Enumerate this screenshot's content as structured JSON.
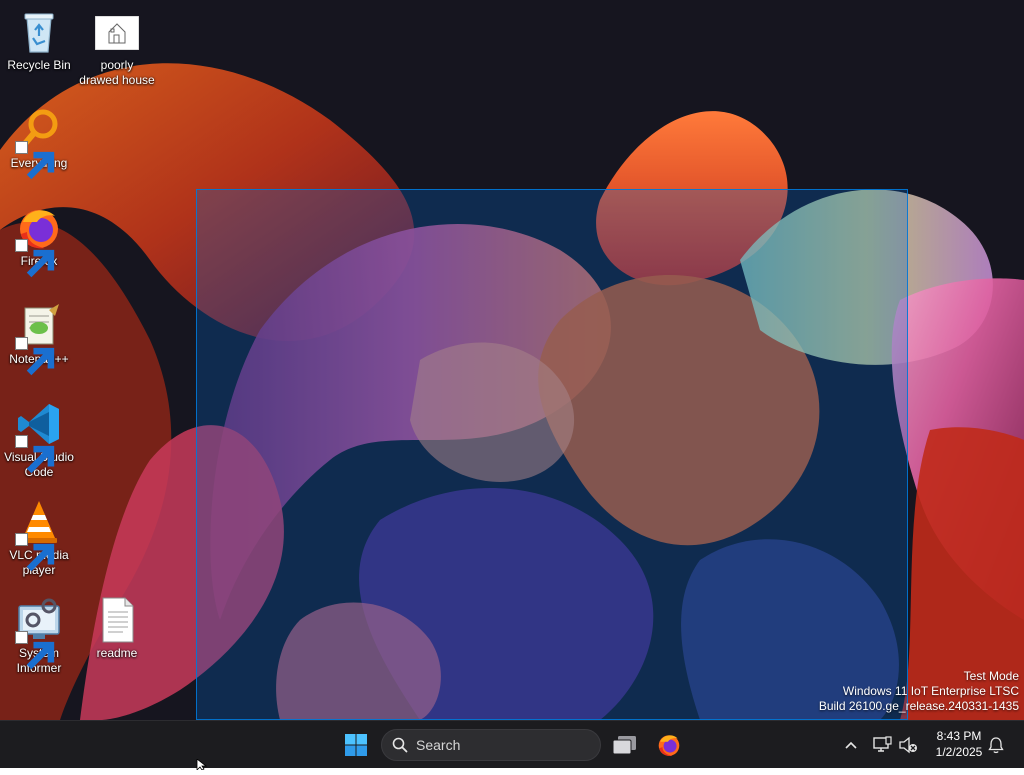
{
  "desktop": {
    "icons": [
      {
        "name": "Recycle Bin",
        "icon": "recycle-bin-icon",
        "shortcut": false
      },
      {
        "name": "poorly\ndrawed house",
        "icon": "image-thumbnail-icon",
        "shortcut": false
      },
      {
        "name": "Everything",
        "icon": "everything-search-icon",
        "shortcut": true
      },
      {
        "name": "Firefox",
        "icon": "firefox-icon",
        "shortcut": true
      },
      {
        "name": "Notepad++",
        "icon": "notepad-plus-plus-icon",
        "shortcut": true
      },
      {
        "name": "Visual Studio\nCode",
        "icon": "vscode-icon",
        "shortcut": true
      },
      {
        "name": "VLC media\nplayer",
        "icon": "vlc-icon",
        "shortcut": true
      },
      {
        "name": "System\nInformer",
        "icon": "system-informer-icon",
        "shortcut": true
      },
      {
        "name": "readme",
        "icon": "text-file-icon",
        "shortcut": false
      }
    ],
    "watermark": {
      "line1": "Test Mode",
      "line2": "Windows 11 IoT Enterprise LTSC",
      "line3": "Build 26100.ge_release.240331-1435"
    }
  },
  "taskbar": {
    "start_icon": "windows-start-icon",
    "search_placeholder": "Search",
    "task_view_icon": "task-view-icon",
    "pinned": [
      {
        "icon": "firefox-icon",
        "label": "Firefox"
      }
    ],
    "tray": {
      "overflow_icon": "chevron-up-icon",
      "network_icon": "network-icon",
      "volume_icon": "volume-muted-icon",
      "time": "8:43 PM",
      "date": "1/2/2025",
      "notification_icon": "bell-icon"
    }
  },
  "colors": {
    "taskbar_bg": "#1c1c1f",
    "selection_fill": "#0066cc",
    "accent": "#0078d7"
  }
}
